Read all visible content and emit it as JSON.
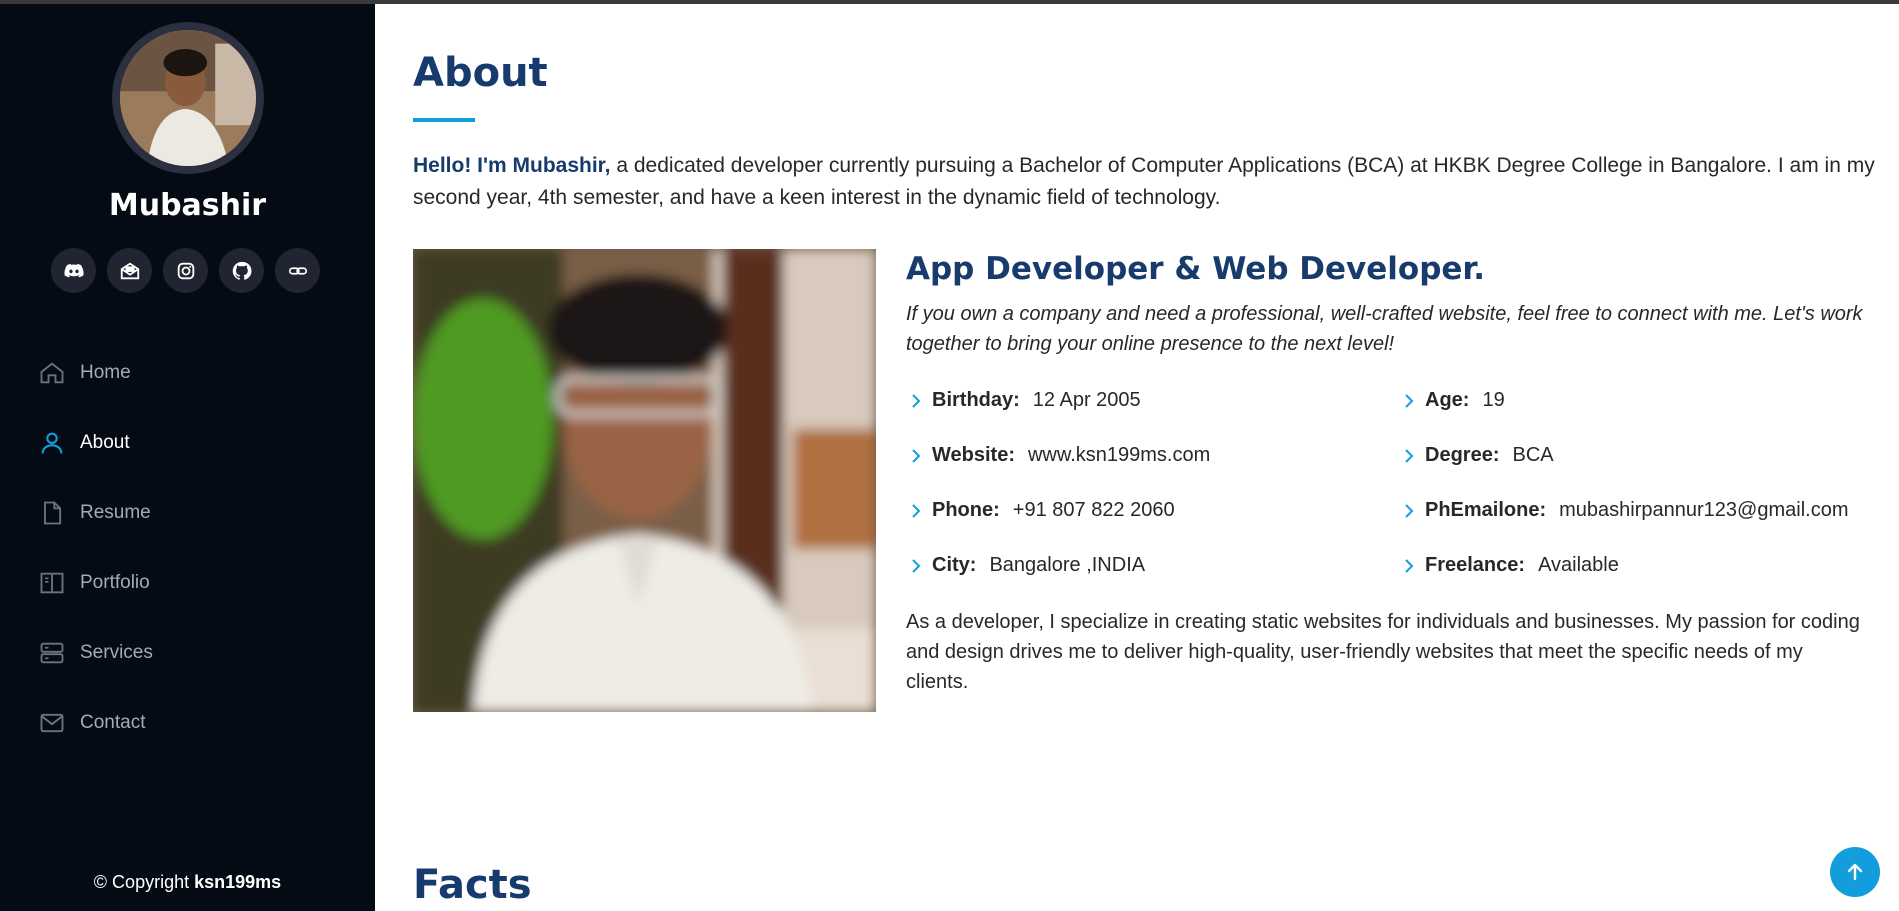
{
  "sidebar": {
    "name": "Mubashir",
    "social": [
      {
        "icon": "discord-icon"
      },
      {
        "icon": "mail-open-icon"
      },
      {
        "icon": "instagram-icon"
      },
      {
        "icon": "github-icon"
      },
      {
        "icon": "link-icon"
      }
    ],
    "nav": [
      {
        "label": "Home",
        "icon": "house-icon",
        "active": false
      },
      {
        "label": "About",
        "icon": "person-icon",
        "active": true
      },
      {
        "label": "Resume",
        "icon": "file-icon",
        "active": false
      },
      {
        "label": "Portfolio",
        "icon": "book-icon",
        "active": false
      },
      {
        "label": "Services",
        "icon": "server-icon",
        "active": false
      },
      {
        "label": "Contact",
        "icon": "envelope-icon",
        "active": false
      }
    ],
    "copyright_prefix": "© Copyright",
    "copyright_name": "ksn199ms"
  },
  "about": {
    "title": "About",
    "intro_bold": "Hello! I'm Mubashir,",
    "intro_text": " a dedicated developer currently pursuing a Bachelor of Computer Applications (BCA) at HKBK Degree College in Bangalore. I am in my second year, 4th semester, and have a keen interest in the dynamic field of technology.",
    "role_title": "App Developer & Web Developer.",
    "role_desc": "If you own a company and need a professional, well-crafted website, feel free to connect with me. Let's work together to bring your online presence to the next level!",
    "info": [
      {
        "key": "Birthday:",
        "value": "12 Apr 2005"
      },
      {
        "key": "Age:",
        "value": "19"
      },
      {
        "key": "Website:",
        "value": "www.ksn199ms.com"
      },
      {
        "key": "Degree:",
        "value": "BCA"
      },
      {
        "key": "Phone:",
        "value": "+91 807 822 2060"
      },
      {
        "key": "PhEmailone:",
        "value": "mubashirpannur123@gmail.com"
      },
      {
        "key": "City:",
        "value": "Bangalore ,INDIA"
      },
      {
        "key": "Freelance:",
        "value": "Available"
      }
    ],
    "closing": "As a developer, I specialize in creating static websites for individuals and businesses. My passion for coding and design drives me to deliver high-quality, user-friendly websites that meet the specific needs of my clients."
  },
  "facts": {
    "title": "Facts"
  },
  "colors": {
    "sidebar_bg": "#040b14",
    "accent": "#149ddd",
    "heading": "#173b6c",
    "nav_text": "#a8a9b4"
  }
}
